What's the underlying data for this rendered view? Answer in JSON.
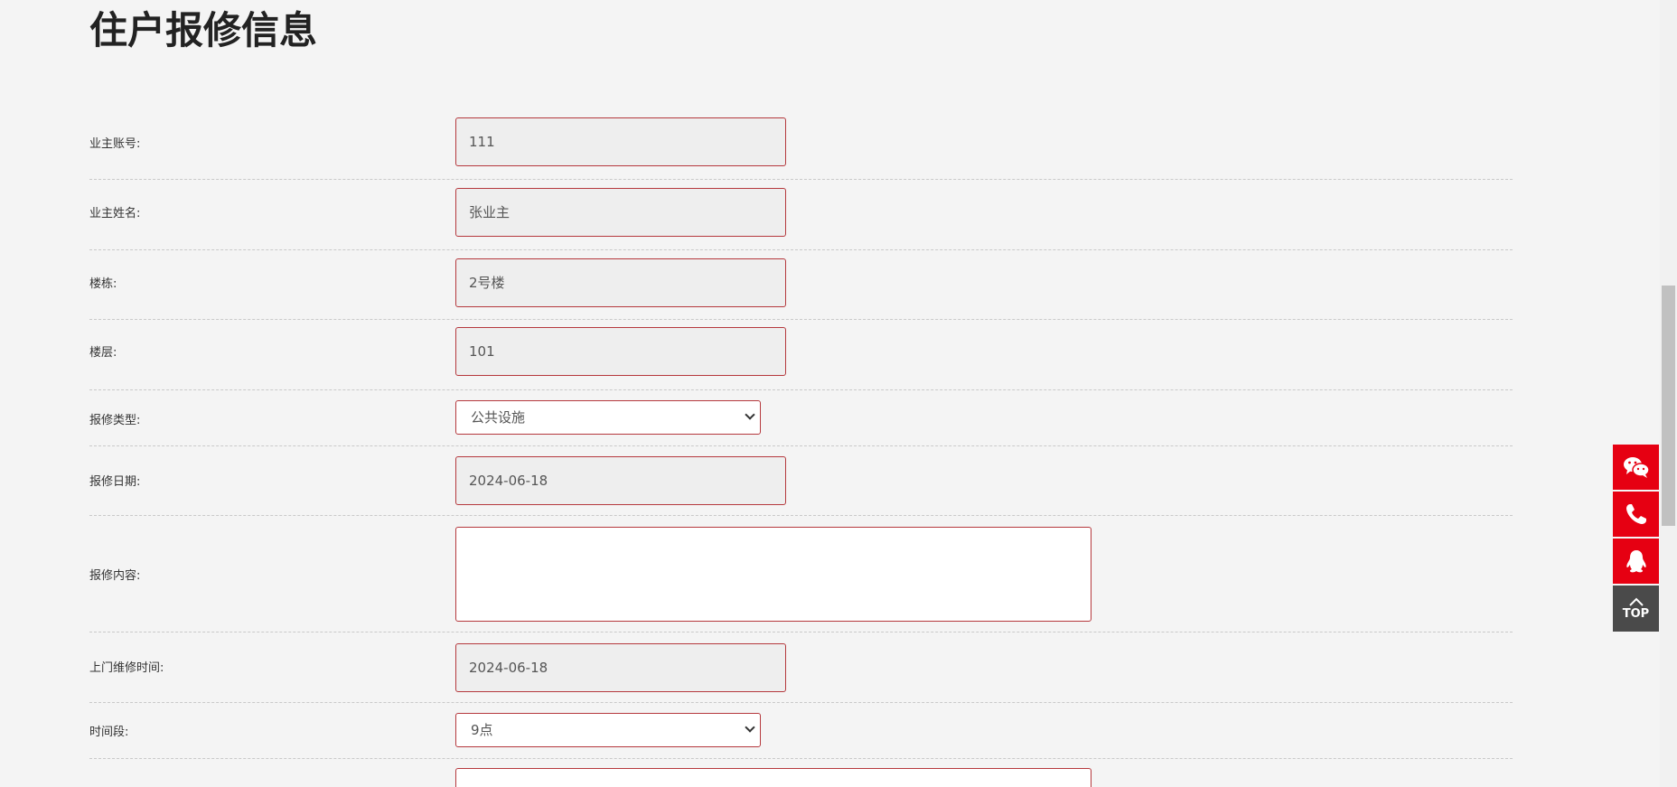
{
  "page": {
    "title": "住户报修信息"
  },
  "form": {
    "owner_account": {
      "label": "业主账号:",
      "value": "111"
    },
    "owner_name": {
      "label": "业主姓名:",
      "value": "张业主"
    },
    "building": {
      "label": "楼栋:",
      "value": "2号楼"
    },
    "floor": {
      "label": "楼层:",
      "value": "101"
    },
    "repair_type": {
      "label": "报修类型:",
      "selected": "公共设施"
    },
    "repair_date": {
      "label": "报修日期:",
      "value": "2024-06-18"
    },
    "repair_content": {
      "label": "报修内容:",
      "value": ""
    },
    "visit_time": {
      "label": "上门维修时间:",
      "value": "2024-06-18"
    },
    "time_slot": {
      "label": "时间段:",
      "selected": "9点"
    }
  },
  "side_tools": {
    "top_label": "TOP"
  },
  "colors": {
    "page_bg": "#f4f4f4",
    "field_border": "#b5383d",
    "field_readonly_bg": "#eeeeee",
    "tool_red": "#e60012",
    "tool_dark": "#4a4a4a"
  }
}
